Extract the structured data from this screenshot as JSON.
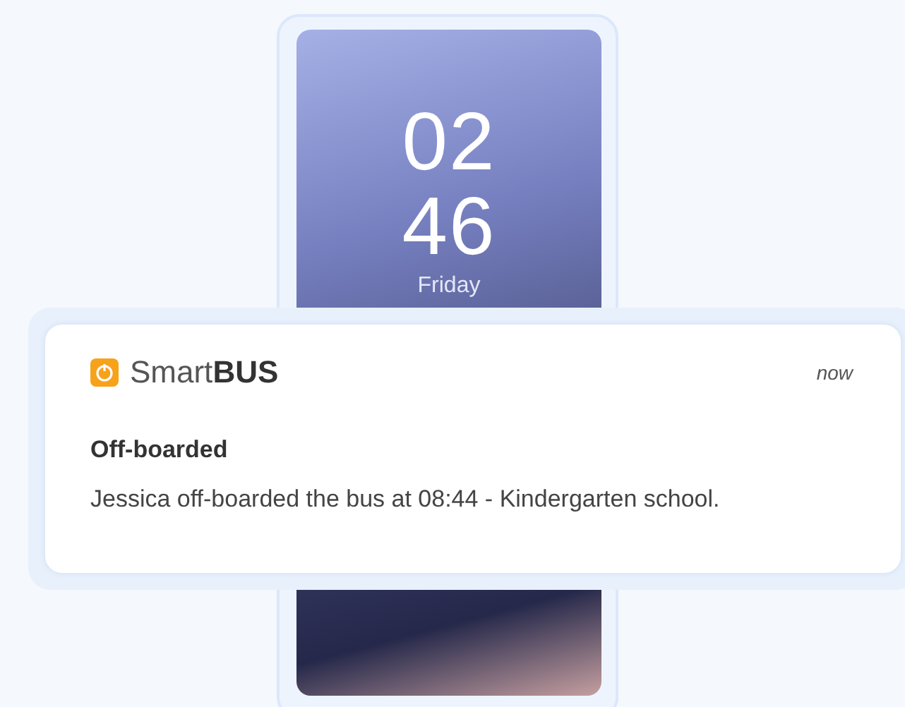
{
  "phone": {
    "clock": {
      "hour": "02",
      "minute": "46",
      "day": "Friday"
    }
  },
  "notification": {
    "app_name": "Smart**BUS**",
    "time": "now",
    "title": "Off-boarded",
    "body": "Jessica off-boarded the bus at 08:44 - Kindergarten school."
  }
}
